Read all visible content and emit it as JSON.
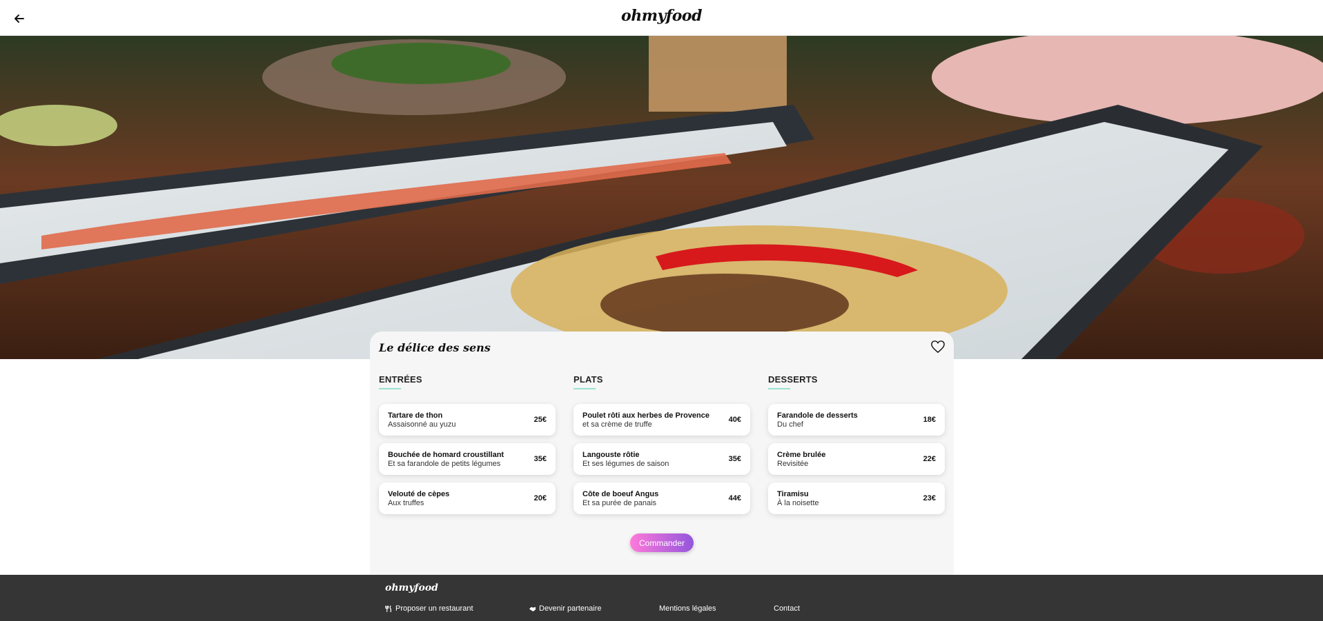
{
  "header": {
    "logo": "ohmyfood"
  },
  "restaurant": {
    "name": "Le délice des sens"
  },
  "menu": {
    "columns": [
      {
        "title": "ENTRÉES",
        "dishes": [
          {
            "name": "Tartare de thon",
            "desc": "Assaisonné au yuzu",
            "price": "25€"
          },
          {
            "name": "Bouchée de homard croustillant",
            "desc": "Et sa farandole de petits légumes",
            "price": "35€"
          },
          {
            "name": "Velouté de cèpes",
            "desc": "Aux truffes",
            "price": "20€"
          }
        ]
      },
      {
        "title": "PLATS",
        "dishes": [
          {
            "name": "Poulet rôti aux herbes de Provence",
            "desc": "et sa crème de truffe",
            "price": "40€"
          },
          {
            "name": "Langouste rôtie",
            "desc": "Et ses légumes de saison",
            "price": "35€"
          },
          {
            "name": "Côte de boeuf Angus",
            "desc": "Et sa purée de panais",
            "price": "44€"
          }
        ]
      },
      {
        "title": "DESSERTS",
        "dishes": [
          {
            "name": "Farandole de desserts",
            "desc": "Du chef",
            "price": "18€"
          },
          {
            "name": "Crème brulée",
            "desc": "Revisitée",
            "price": "22€"
          },
          {
            "name": "Tiramisu",
            "desc": "À la noisette",
            "price": "23€"
          }
        ]
      }
    ]
  },
  "order_button": "Commander",
  "footer": {
    "logo": "ohmyfood",
    "links": [
      {
        "label": "Proposer un restaurant",
        "icon": "utensils-icon"
      },
      {
        "label": "Devenir partenaire",
        "icon": "handshake-icon"
      },
      {
        "label": "Mentions légales",
        "icon": ""
      },
      {
        "label": "Contact",
        "icon": ""
      }
    ]
  },
  "colors": {
    "accent_gradient_start": "#ff79da",
    "accent_gradient_end": "#9356dc",
    "underline": "#99e2d0",
    "footer_bg": "#353535"
  }
}
